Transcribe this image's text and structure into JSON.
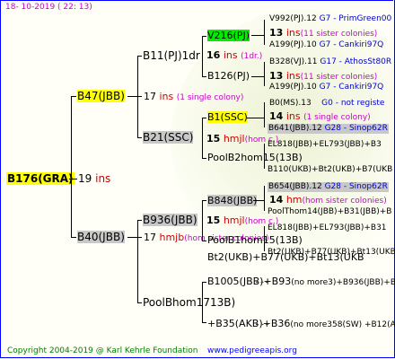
{
  "header": {
    "date": "18- 10-2019 ( 22: 13)"
  },
  "footer": {
    "copyright": "Copyright 2004-2019 @ Karl Kehrle Foundation",
    "site": "www.pedigreeapis.org"
  },
  "root": {
    "name": "B176(GRA)",
    "num": "19",
    "ins": "ins"
  },
  "l1": [
    {
      "name": "B47(JBB)",
      "num": "17",
      "ins": "ins",
      "note": "(1 single colony)"
    },
    {
      "name": "B40(JBB)",
      "num": "17",
      "ins": "hmjb",
      "note": "(hom sister colonies)"
    }
  ],
  "l2": [
    {
      "name": "B11(PJ)1dr",
      "num": "16",
      "ins": "ins",
      "note": "(1dr.)"
    },
    {
      "name": "B21(SSC)",
      "num": "15",
      "ins": "hmjl",
      "note": "(hom c.)"
    },
    {
      "name": "B936(JBB)",
      "num": "15",
      "ins": "hmjl",
      "note": "(hom c.)"
    },
    {
      "name": "PoolBhom1713B)",
      "num": "",
      "ins": "",
      "note": ""
    }
  ],
  "l3": [
    {
      "name": "V216(PJ)",
      "num": "13",
      "ins": "ins",
      "note": "(11 sister colonies)"
    },
    {
      "name": "B126(PJ)",
      "num": "13",
      "ins": "ins",
      "note": "(11 sister colonies)"
    },
    {
      "name": "B1(SSC)",
      "num": "14",
      "ins": "ins",
      "note": "(1 single colony)"
    },
    {
      "name": "PoolB2hom15(13B)",
      "num": "",
      "ins": "",
      "note": ""
    },
    {
      "name": "B848(JBB)",
      "num": "14",
      "ins": "hm",
      "note": "(hom sister colonies)"
    },
    {
      "name": "PoolB1hom15(13B)",
      "num": "",
      "ins": "",
      "note": ""
    },
    {
      "name": "B1005(JBB)+B93",
      "num": "",
      "ins": "",
      "note": "(no more3)+B936(JBB)+B94"
    },
    {
      "name": "+B35(AKB)+B36",
      "num": "",
      "ins": "",
      "note": "(no more358(SW) +B12(ASH"
    }
  ],
  "l4": [
    {
      "name": "V992(PJ).12",
      "extra": "G7 - PrimGreen00"
    },
    {
      "name": "A199(PJ).10",
      "extra": "G7 - Cankiri97Q"
    },
    {
      "name": "B328(VJ).11",
      "extra": "G17 - AthosSt80R"
    },
    {
      "name": "A199(PJ).10",
      "extra": "G7 - Cankiri97Q"
    },
    {
      "name": "B0(MS).13",
      "extra": "G0 - not registe"
    },
    {
      "name": "B641(JBB).12",
      "extra": "G28 - Sinop62R"
    },
    {
      "name": "EL818(JBB)+EL793(JBB)+B3",
      "extra": ""
    },
    {
      "name": "B110(UKB)+Bt2(UKB)+B7(UKB",
      "extra": ""
    },
    {
      "name": "B654(JBB).12",
      "extra": "G28 - Sinop62R"
    },
    {
      "name": "PoolThom14(JBB)+B31(JBB)+B",
      "extra": ""
    },
    {
      "name": "EL818(JBB)+EL793(JBB)+B31",
      "extra": ""
    },
    {
      "name": "Bt2(UKB)+B77(UKB)+Bt13(UKB",
      "extra": ""
    }
  ],
  "l4_notes": [
    "(11 sister colonies)",
    "(hom sister colonies)"
  ]
}
